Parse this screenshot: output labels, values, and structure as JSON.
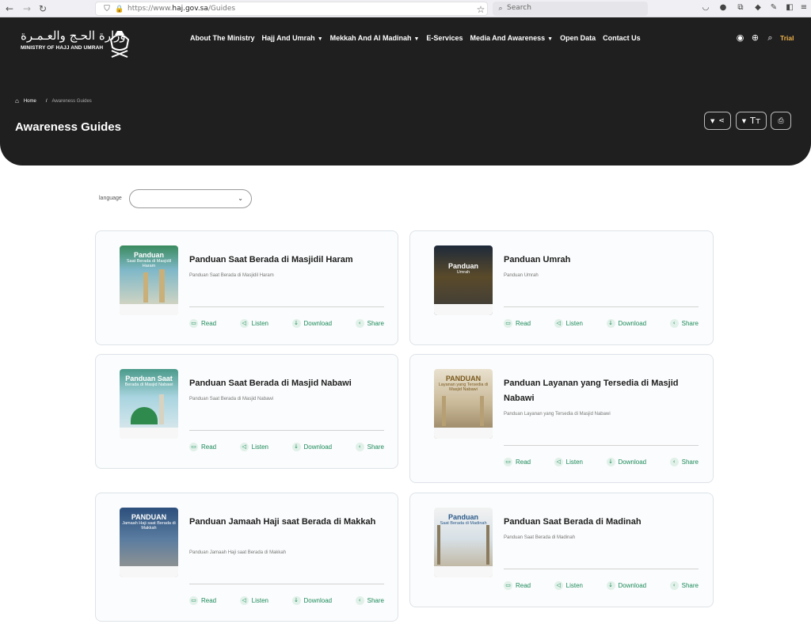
{
  "browser": {
    "url_prefix": "https://www.",
    "url_host": "haj.gov.sa",
    "url_path": "/Guides",
    "search_placeholder": "Search"
  },
  "header": {
    "logo_arabic": "وزارة الحـج والعـمـرة",
    "logo_english": "MINISTRY OF HAJJ AND UMRAH",
    "nav": [
      {
        "label": "About The Ministry",
        "has_dropdown": false
      },
      {
        "label": "Hajj And Umrah",
        "has_dropdown": true
      },
      {
        "label": "Mekkah And Al Madinah",
        "has_dropdown": true
      },
      {
        "label": "E-Services",
        "has_dropdown": false
      },
      {
        "label": "Media And Awareness",
        "has_dropdown": true
      },
      {
        "label": "Open Data",
        "has_dropdown": false
      },
      {
        "label": "Contact Us",
        "has_dropdown": false
      }
    ],
    "trial_label": "Trial"
  },
  "breadcrumb": {
    "home": "Home",
    "separator": "/",
    "current": "Awareness Guides"
  },
  "page_title": "Awareness Guides",
  "filter": {
    "language_label": "language",
    "language_value": ""
  },
  "actions": {
    "read": "Read",
    "listen": "Listen",
    "download": "Download",
    "share": "Share"
  },
  "guides": [
    {
      "title": "Panduan Saat Berada di Masjidil Haram",
      "description": "Panduan Saat Berada di Masjidil Haram",
      "cover_title": "Panduan",
      "cover_sub": "Saat Berada di Masjidil Haram"
    },
    {
      "title": "Panduan Umrah",
      "description": "Panduan Umrah",
      "cover_title": "Panduan",
      "cover_sub": "Umrah"
    },
    {
      "title": "Panduan Saat Berada di Masjid Nabawi",
      "description": "Panduan Saat Berada di Masjid Nabawi",
      "cover_title": "Panduan Saat",
      "cover_sub": "Berada di Masjid Nabawi"
    },
    {
      "title": "Panduan Layanan yang Tersedia di Masjid Nabawi",
      "description": "Panduan Layanan yang Tersedia di Masjid Nabawi",
      "cover_title": "PANDUAN",
      "cover_sub": "Layanan yang Tersedia di Masjid Nabawi"
    },
    {
      "title": "Panduan Jamaah Haji saat Berada di Makkah",
      "description": "Panduan Jamaah Haji saat Berada di Makkah",
      "cover_title": "PANDUAN",
      "cover_sub": "Jamaah Haji saat Berada di Makkah"
    },
    {
      "title": "Panduan Saat Berada di Madinah",
      "description": "Panduan Saat Berada di Madinah",
      "cover_title": "Panduan",
      "cover_sub": "Saat Berada di Madinah"
    }
  ],
  "colors": {
    "hero_bg": "#1f1f1f",
    "accent_green": "#1b8a5a",
    "trial_orange": "#f0b34a"
  }
}
